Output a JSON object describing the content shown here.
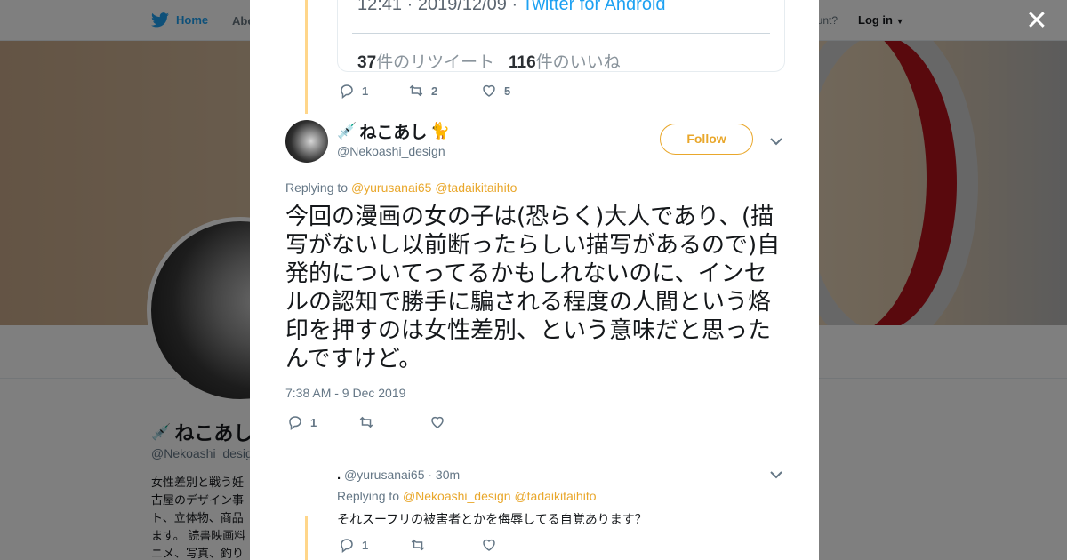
{
  "colors": {
    "accent": "#e9a72b",
    "twitter_blue": "#1da1f2",
    "thread_line": "#ffd68a"
  },
  "topnav": {
    "home_label": "Home",
    "about_label": "Abo",
    "account_label": "ccount?",
    "login_label": "Log in"
  },
  "profile": {
    "name": "ねこあし",
    "handle": "@Nekoashi_desig",
    "bio": "女性差別と戦う妊\n古屋のデザイン事\nト、立体物、商品\nます。 読書映画料\nニメ、写真、釣り"
  },
  "quoted_tweet": {
    "time_prefix": "12:41 · 2019/12/09 · ",
    "client": "Twitter for Android",
    "retweet_count": "37",
    "retweet_label": "件のリツイート",
    "like_count": "116",
    "like_label": "件のいいね"
  },
  "prev_tweet_actions": {
    "reply_count": "1",
    "retweet_count": "2",
    "like_count": "5"
  },
  "main_tweet": {
    "display_name": "ねこあし",
    "handle": "@Nekoashi_design",
    "follow_label": "Follow",
    "replying_to_label": "Replying to",
    "mention_1": "@yurusanai65",
    "mention_2": "@tadaikitaihito",
    "text": "今回の漫画の女の子は(恐らく)大人であり、(描写がないし以前断ったらしい描写があるので)自発的についてってるかもしれないのに、インセルの認知で勝手に騙される程度の人間という烙印を押すのは女性差別、という意味だと思ったんですけど。",
    "timestamp": "7:38 AM - 9 Dec 2019",
    "reply_count": "1",
    "retweet_count": "",
    "like_count": ""
  },
  "reply_tweet": {
    "display_name": ".",
    "handle_time": "@yurusanai65 · 30m",
    "replying_to_label": "Replying to",
    "mention_1": "@Nekoashi_design",
    "mention_2": "@tadaikitaihito",
    "text": "それスーフリの被害者とかを侮辱してる自覚あります？",
    "reply_count": "1",
    "retweet_count": "",
    "like_count": ""
  }
}
